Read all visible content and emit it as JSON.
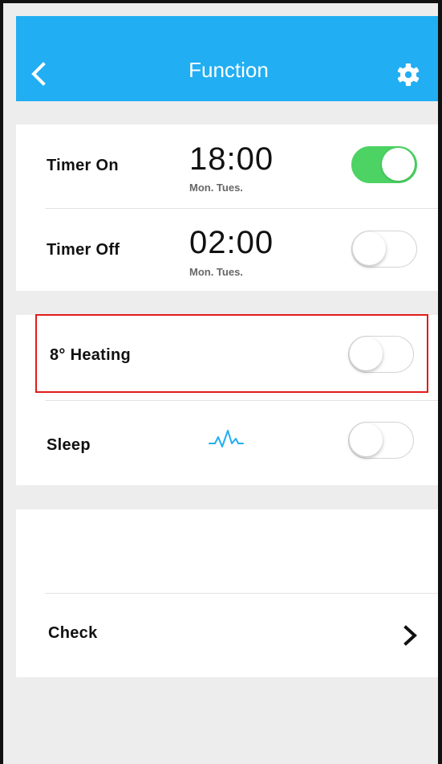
{
  "header": {
    "title": "Function",
    "back_icon": "chevron-left-icon",
    "settings_icon": "gear-icon",
    "background": "#21aef3"
  },
  "rows": {
    "timer_on": {
      "label": "Timer On",
      "time": "18:00",
      "days": "Mon. Tues.",
      "toggle_on": true
    },
    "timer_off": {
      "label": "Timer Off",
      "time": "02:00",
      "days": "Mon. Tues.",
      "toggle_on": false
    },
    "heating": {
      "label": "8° Heating",
      "toggle_on": false,
      "highlighted": true
    },
    "sleep": {
      "label": "Sleep",
      "icon": "pulse-icon",
      "toggle_on": false
    },
    "check": {
      "label": "Check",
      "icon": "chevron-right-icon"
    }
  },
  "colors": {
    "accent": "#21aef3",
    "toggle_on": "#4cd363",
    "highlight": "#e21b1b"
  }
}
